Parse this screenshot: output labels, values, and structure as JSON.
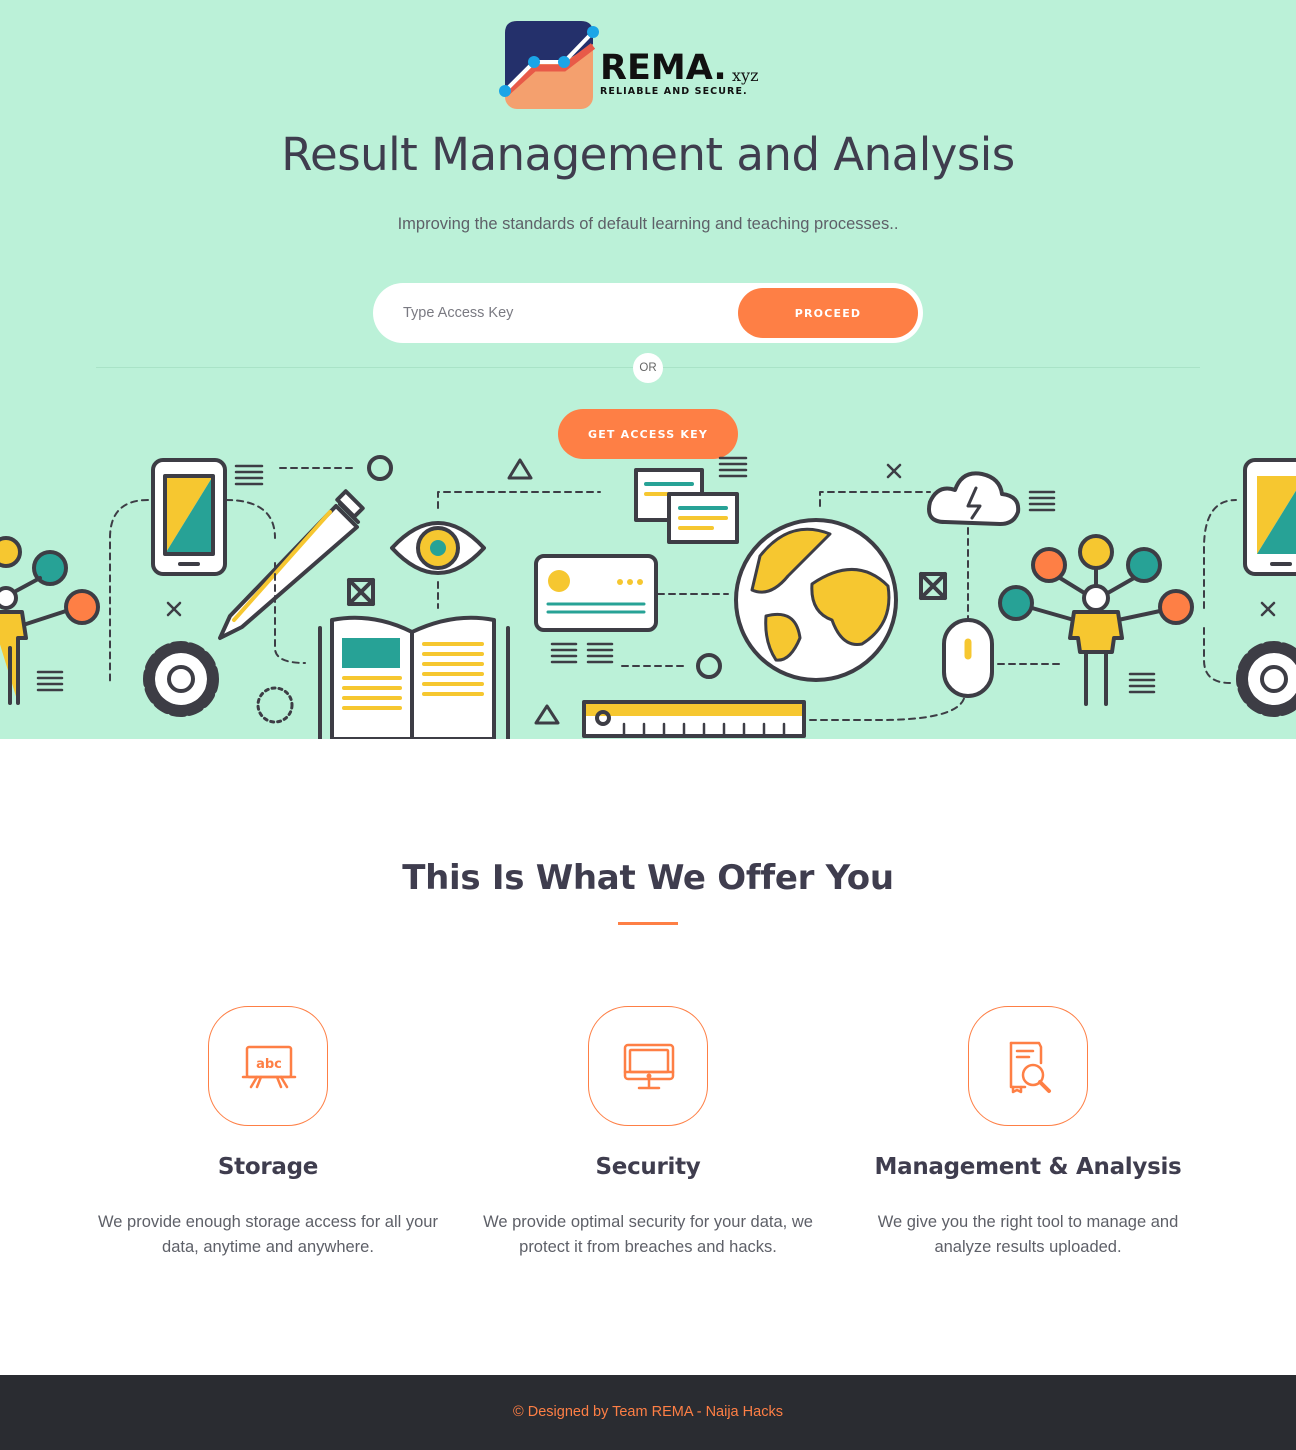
{
  "brand": {
    "name": "REMA.",
    "tld": "xyz",
    "tagline": "RELIABLE AND SECURE."
  },
  "hero": {
    "title": "Result Management and Analysis",
    "subtitle": "Improving the standards of default learning and teaching processes..",
    "access_key_placeholder": "Type Access Key",
    "proceed_label": "PROCEED",
    "or_label": "OR",
    "get_key_label": "GET ACCESS KEY"
  },
  "offers": {
    "title": "This Is What We Offer You",
    "items": [
      {
        "icon": "abc-board-icon",
        "title": "Storage",
        "description": "We provide enough storage access for all your data, anytime and anywhere."
      },
      {
        "icon": "monitor-icon",
        "title": "Security",
        "description": "We provide optimal security for your data, we protect it from breaches and hacks."
      },
      {
        "icon": "document-search-icon",
        "title": "Management & Analysis",
        "description": "We give you the right tool to manage and analyze results uploaded."
      }
    ]
  },
  "footer": {
    "credit": "© Designed by Team REMA - Naija Hacks"
  },
  "colors": {
    "hero_bg": "#bbf1d8",
    "accent": "#fe7f45",
    "heading": "#3f3d4e",
    "footer_bg": "#2a2c31",
    "illustration_yellow": "#f6c730",
    "illustration_teal": "#27a296",
    "illustration_line": "#3d3d45"
  }
}
